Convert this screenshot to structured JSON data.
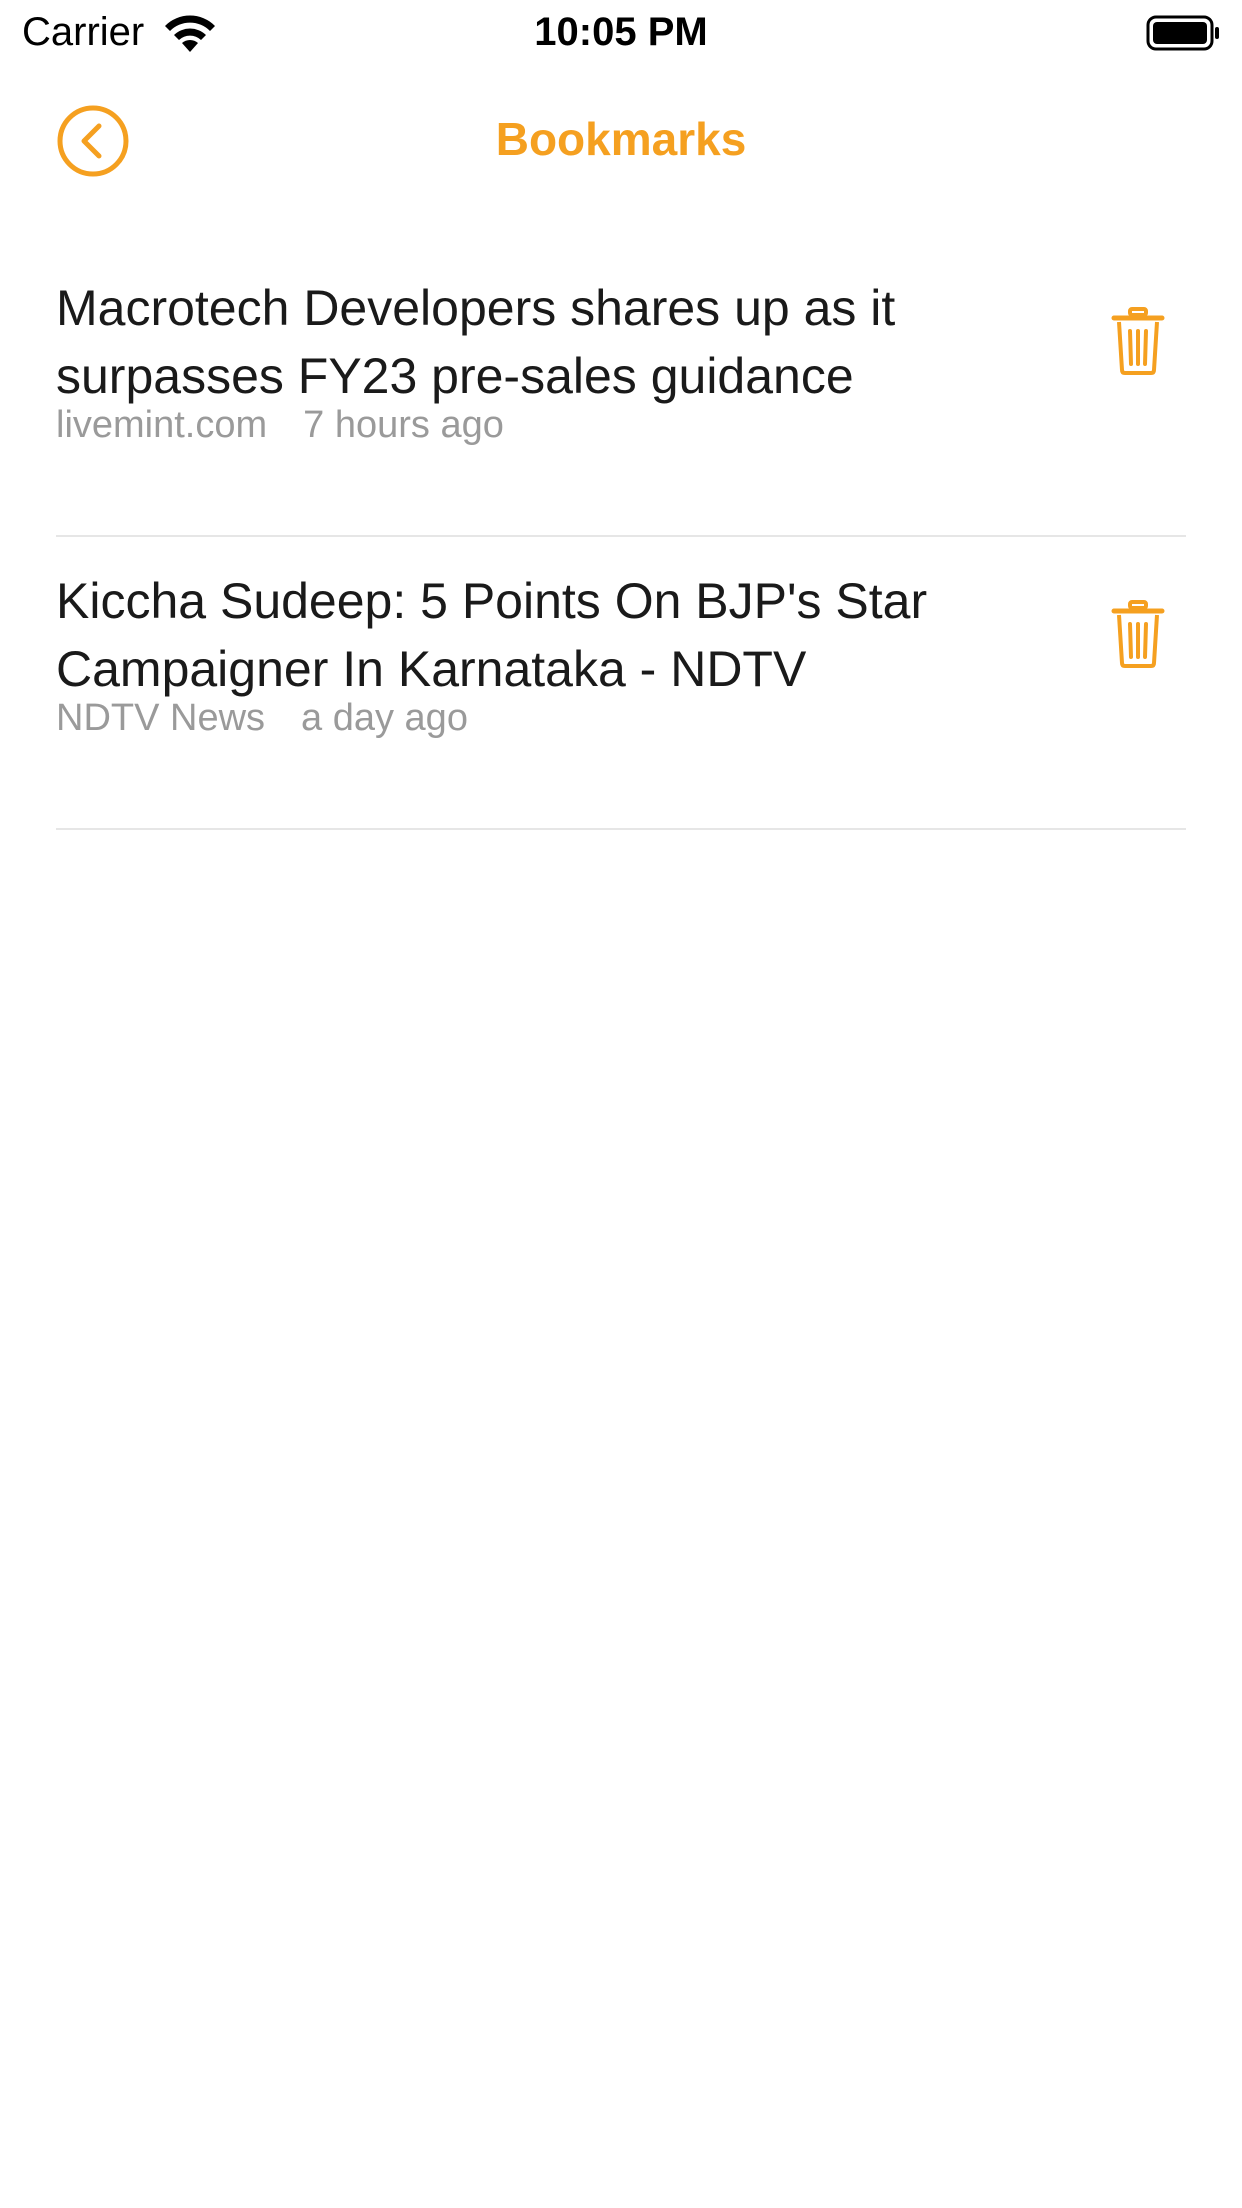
{
  "status_bar": {
    "carrier": "Carrier",
    "time": "10:05 PM"
  },
  "nav": {
    "title": "Bookmarks",
    "back_icon": "chevron-left-circle-icon"
  },
  "bookmarks": [
    {
      "headline": "Macrotech Developers shares up as it surpasses FY23 pre-sales guidance",
      "source": "livemint.com",
      "time": "7 hours ago"
    },
    {
      "headline": "Kiccha Sudeep: 5 Points On BJP's Star Campaigner In Karnataka - NDTV",
      "source": "NDTV News",
      "time": "a day ago"
    }
  ],
  "colors": {
    "accent": "#f5a020",
    "headline": "#1a1a1a",
    "meta": "#9a9a9a",
    "divider": "#e6e6e6"
  },
  "icons": {
    "delete": "trash-icon",
    "wifi": "wifi-icon",
    "battery": "battery-icon"
  }
}
